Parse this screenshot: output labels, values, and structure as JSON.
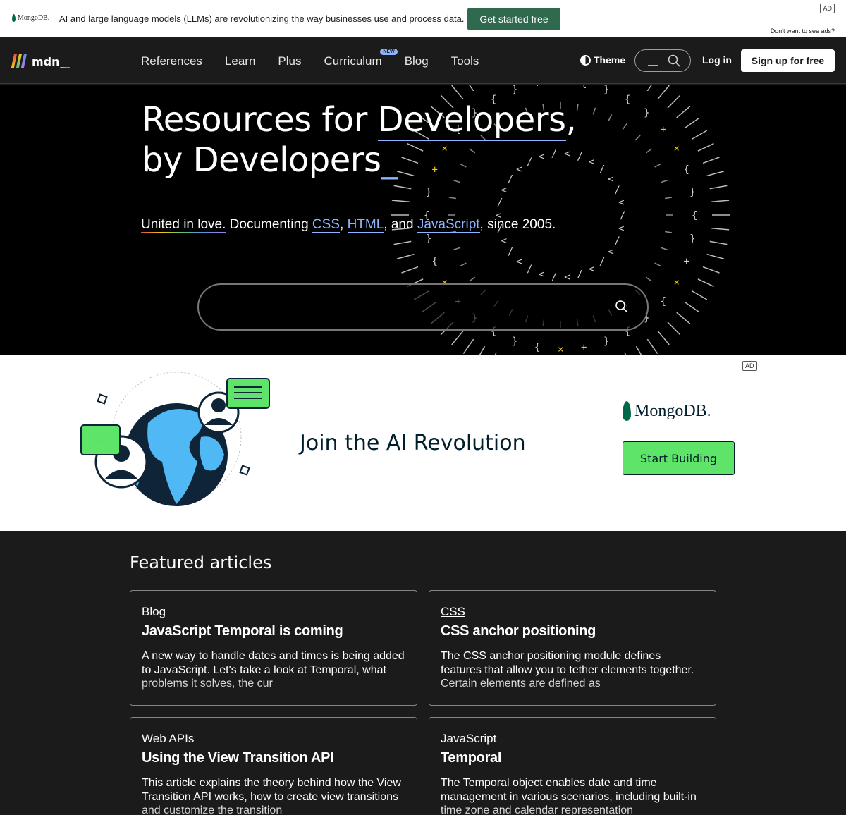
{
  "top_ad": {
    "brand": "MongoDB.",
    "message": "AI and large language models (LLMs) are revolutionizing the way businesses use and process data.",
    "cta": "Get started free",
    "ad_label": "AD",
    "no_ads": "Don't want to see ads?"
  },
  "nav": {
    "logo": "mdn",
    "links": [
      "References",
      "Learn",
      "Plus",
      "Curriculum",
      "Blog",
      "Tools"
    ],
    "new_badge": "NEW",
    "theme": "Theme",
    "login": "Log in",
    "signup": "Sign up for free"
  },
  "hero": {
    "title_1": "Resources for ",
    "title_dev": "Developers",
    "title_comma": ",",
    "title_2": "by Developers",
    "title_cursor": "_",
    "tagline_love": "United in love.",
    "tagline_mid": " Documenting ",
    "tech_css": "CSS",
    "sep_1": ", ",
    "tech_html": "HTML",
    "sep_2": ", and ",
    "tech_js": "JavaScript",
    "tagline_end": ", since 2005."
  },
  "banner_ad": {
    "headline": "Join the AI Revolution",
    "brand": "MongoDB.",
    "cta": "Start Building",
    "ad_label": "AD"
  },
  "featured": {
    "title": "Featured articles",
    "cards": [
      {
        "category": "Blog",
        "title": "JavaScript Temporal is coming",
        "description": "A new way to handle dates and times is being added to JavaScript. Let's take a look at Temporal, what problems it solves, the cur"
      },
      {
        "category": "CSS",
        "title": "CSS anchor positioning",
        "description": "The CSS anchor positioning module defines features that allow you to tether elements together. Certain elements are defined as"
      },
      {
        "category": "Web APIs",
        "title": "Using the View Transition API",
        "description": "This article explains the theory behind how the View Transition API works, how to create view transitions and customize the transition"
      },
      {
        "category": "JavaScript",
        "title": "Temporal",
        "description": "The Temporal object enables date and time management in various scenarios, including built-in time zone and calendar representation"
      }
    ]
  },
  "colors": {
    "accent": "#8cb4ff",
    "mongo_green": "#00684a",
    "cta_green": "#2f6a4f",
    "banner_button": "#5fe46a",
    "hero_yellow": "#f9c80e"
  }
}
